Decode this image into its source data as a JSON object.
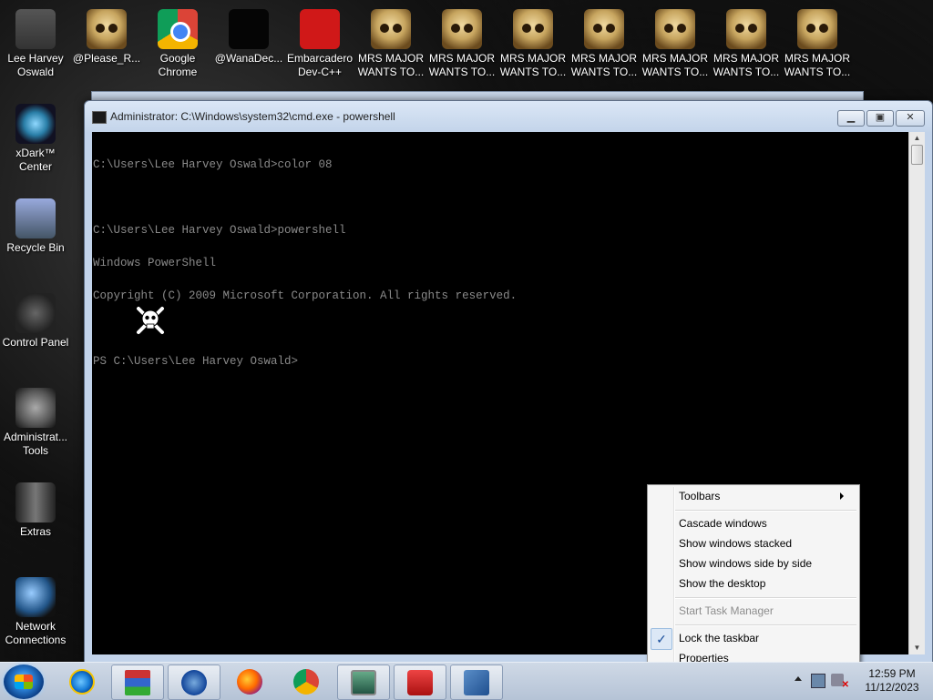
{
  "desktop": {
    "icons_top": [
      {
        "label": "Lee Harvey Oswald",
        "icon": "user-avatar-icon"
      },
      {
        "label": "@Please_R...",
        "icon": "skull-icon"
      },
      {
        "label": "Google Chrome",
        "icon": "chrome-icon"
      },
      {
        "label": "@WanaDec...",
        "icon": "black-file-icon"
      },
      {
        "label": "Embarcadero Dev-C++",
        "icon": "devcpp-icon"
      },
      {
        "label": "MRS MAJOR WANTS TO...",
        "icon": "skull-icon"
      },
      {
        "label": "MRS MAJOR WANTS TO...",
        "icon": "skull-icon"
      },
      {
        "label": "MRS MAJOR WANTS TO...",
        "icon": "skull-icon"
      },
      {
        "label": "MRS MAJOR WANTS TO...",
        "icon": "skull-icon"
      },
      {
        "label": "MRS MAJOR WANTS TO...",
        "icon": "skull-icon"
      },
      {
        "label": "MRS MAJOR WANTS TO...",
        "icon": "skull-icon"
      },
      {
        "label": "MRS MAJOR WANTS TO...",
        "icon": "skull-icon"
      }
    ],
    "icons_left": [
      {
        "label": "xDark™ Center",
        "icon": "xdark-icon"
      },
      {
        "label": "Recycle Bin",
        "icon": "recycle-bin-icon"
      },
      {
        "label": "Control Panel",
        "icon": "control-panel-icon"
      },
      {
        "label": "Administrat... Tools",
        "icon": "admin-tools-icon"
      },
      {
        "label": "Extras",
        "icon": "folder-icon"
      },
      {
        "label": "Network Connections",
        "icon": "network-icon"
      }
    ]
  },
  "window": {
    "title": "Administrator: C:\\Windows\\system32\\cmd.exe - powershell",
    "minimize": "▁",
    "maximize": "▣",
    "close": "✕",
    "console_lines": [
      "C:\\Users\\Lee Harvey Oswald>color 08",
      "",
      "C:\\Users\\Lee Harvey Oswald>powershell",
      "Windows PowerShell",
      "Copyright (C) 2009 Microsoft Corporation. All rights reserved.",
      "",
      "PS C:\\Users\\Lee Harvey Oswald>"
    ]
  },
  "context_menu": {
    "toolbars": "Toolbars",
    "cascade": "Cascade windows",
    "stacked": "Show windows stacked",
    "side_by_side": "Show windows side by side",
    "show_desktop": "Show the desktop",
    "task_manager": "Start Task Manager",
    "lock_taskbar": "Lock the taskbar",
    "lock_checked": "✓",
    "properties": "Properties"
  },
  "taskbar": {
    "items": [
      "start-button",
      "internet-explorer-icon",
      "winrar-icon",
      "itunes-icon",
      "firefox-icon",
      "chrome-icon",
      "task-monitor-icon",
      "toolbox-icon",
      "cmd-window-icon"
    ],
    "clock_time": "12:59 PM",
    "clock_date": "11/12/2023"
  }
}
